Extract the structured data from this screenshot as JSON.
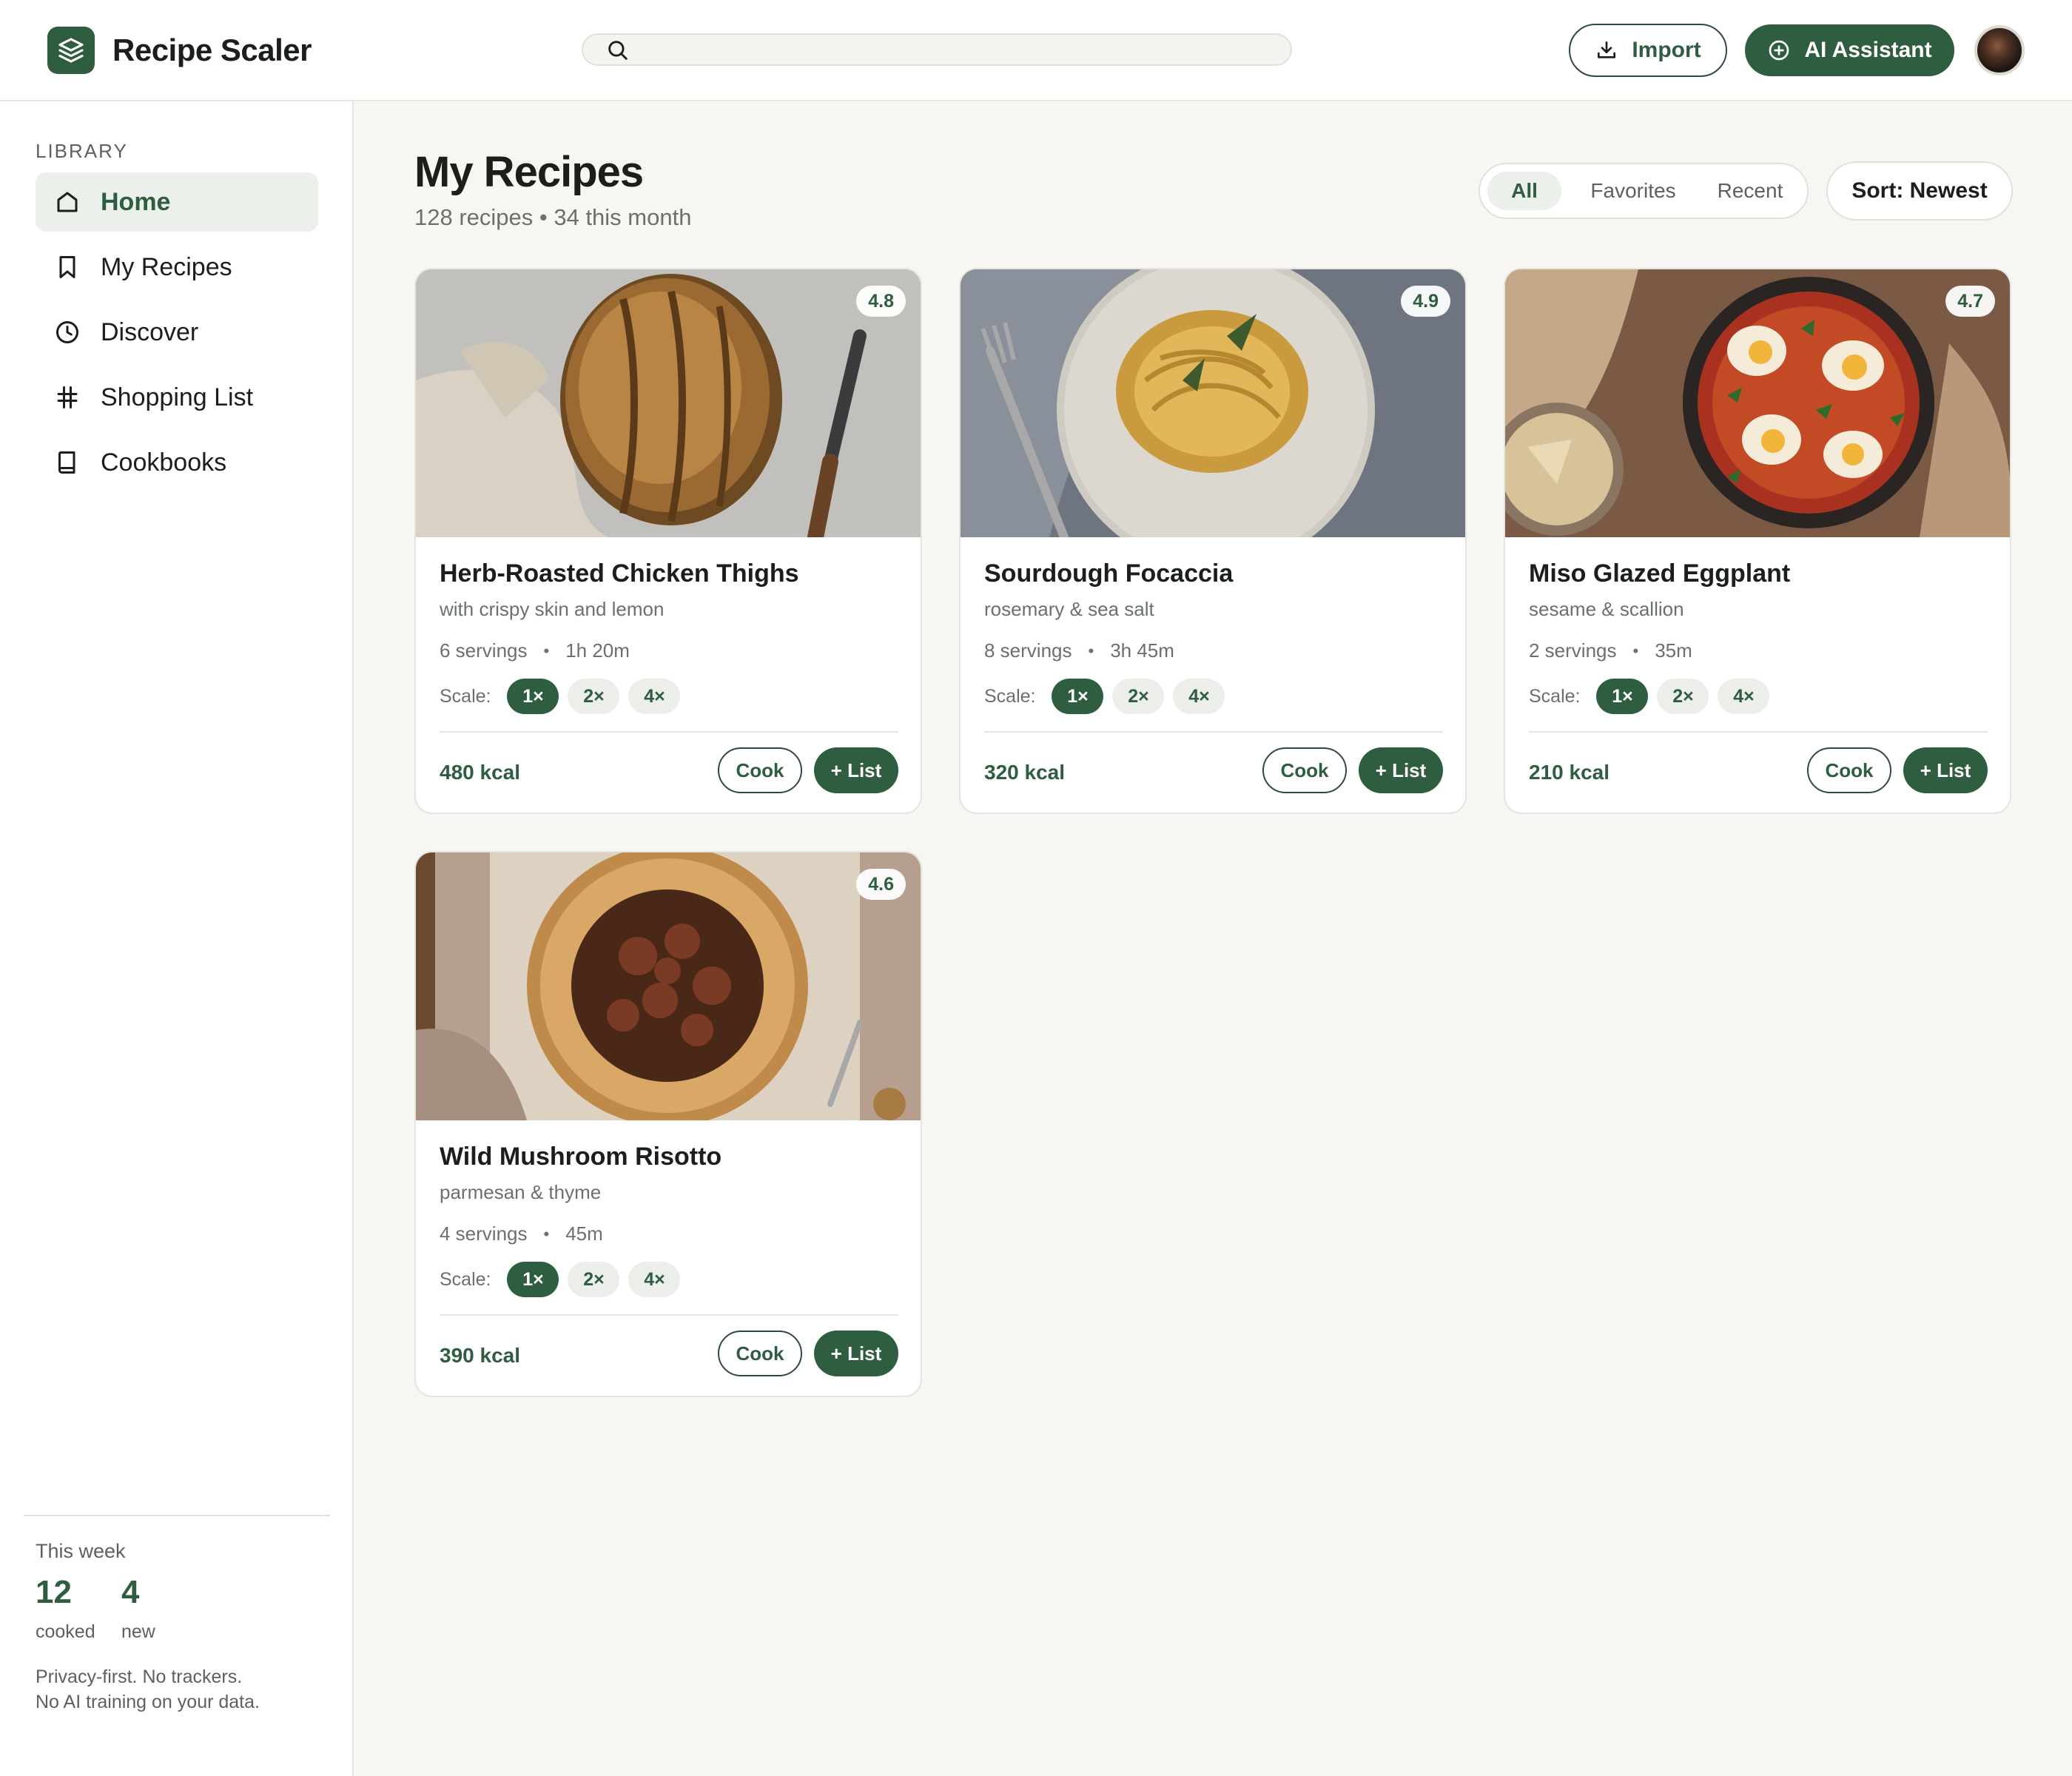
{
  "app": {
    "title": "Recipe Scaler"
  },
  "header": {
    "search": {
      "placeholder": "",
      "value": ""
    },
    "import_label": "Import",
    "ai_label": "AI Assistant"
  },
  "sidebar": {
    "heading": "LIBRARY",
    "items": [
      {
        "label": "Home",
        "icon": "home-icon",
        "active": true
      },
      {
        "label": "My Recipes",
        "icon": "bookmark-icon",
        "active": false
      },
      {
        "label": "Discover",
        "icon": "clock-icon",
        "active": false
      },
      {
        "label": "Shopping List",
        "icon": "hash-icon",
        "active": false
      },
      {
        "label": "Cookbooks",
        "icon": "book-icon",
        "active": false
      }
    ],
    "week": {
      "label": "This week",
      "cooked_value": "12",
      "cooked_label": "cooked",
      "new_value": "4",
      "new_label": "new"
    },
    "privacy_line1": "Privacy-first. No trackers.",
    "privacy_line2": "No AI training on your data."
  },
  "main": {
    "title": "My Recipes",
    "subtitle": "128 recipes • 34 this month",
    "filters": [
      "All",
      "Favorites",
      "Recent"
    ],
    "active_filter": "All",
    "sort_label": "Sort: Newest"
  },
  "recipes": [
    {
      "title": "Herb-Roasted Chicken Thighs",
      "subtitle": "with crispy skin and lemon",
      "servings": "6 servings",
      "time": "1h 20m",
      "rating": "4.8",
      "kcal": "480 kcal",
      "image": "sourdough-loaf-photo"
    },
    {
      "title": "Sourdough Focaccia",
      "subtitle": "rosemary & sea salt",
      "servings": "8 servings",
      "time": "3h 45m",
      "rating": "4.9",
      "kcal": "320 kcal",
      "image": "pasta-plate-photo"
    },
    {
      "title": "Miso Glazed Eggplant",
      "subtitle": "sesame & scallion",
      "servings": "2 servings",
      "time": "35m",
      "rating": "4.7",
      "kcal": "210 kcal",
      "image": "shakshuka-skillet-photo"
    },
    {
      "title": "Wild Mushroom Risotto",
      "subtitle": "parmesan & thyme",
      "servings": "4 servings",
      "time": "45m",
      "rating": "4.6",
      "kcal": "390 kcal",
      "image": "fig-galette-photo"
    }
  ],
  "card_labels": {
    "scale_label": "Scale:",
    "scale_options": [
      "1×",
      "2×",
      "4×"
    ],
    "active_scale": "1×",
    "cook_label": "Cook",
    "list_label": "+ List"
  },
  "colors": {
    "accent": "#2f5d40",
    "accent_soft": "#ebf0ea",
    "background": "#f7f6f2",
    "surface": "#ffffff",
    "muted_text": "#6a716c"
  }
}
